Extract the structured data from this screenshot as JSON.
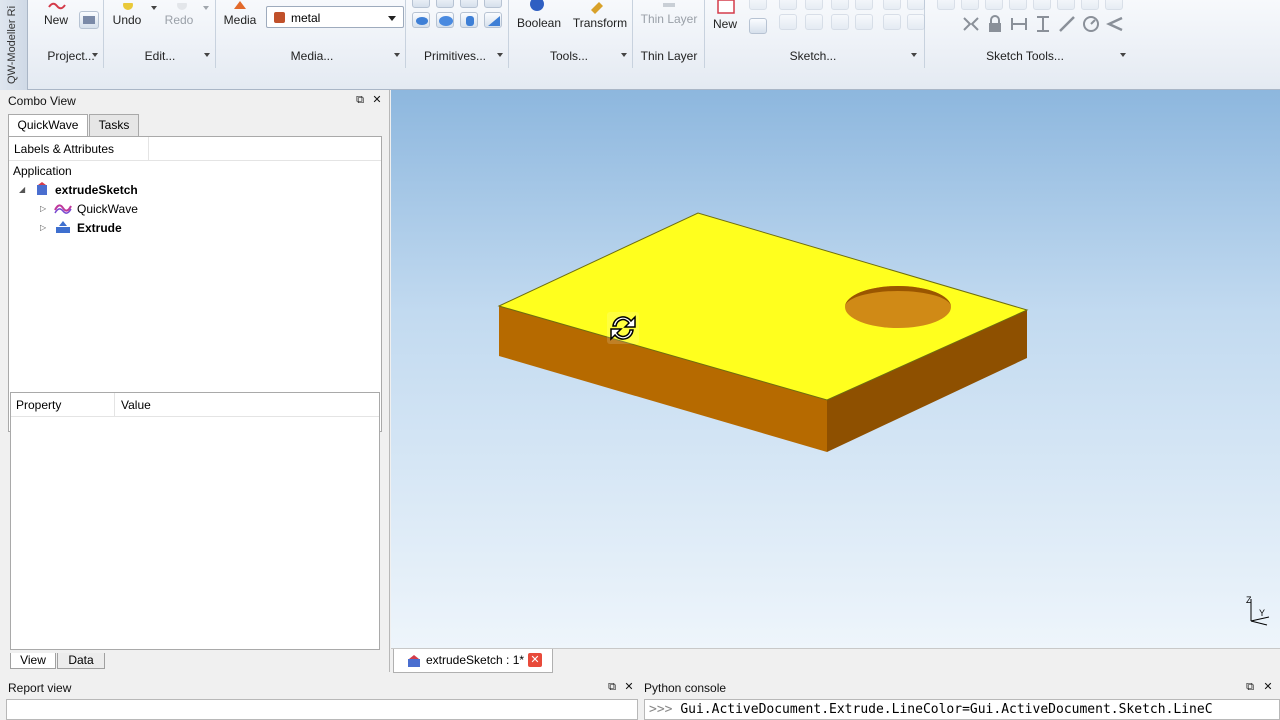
{
  "ribbon": {
    "side_label": "QW-Modeller Ri",
    "groups": {
      "project": {
        "label": "Project...",
        "new_label": "New"
      },
      "edit": {
        "label": "Edit...",
        "undo_label": "Undo",
        "redo_label": "Redo"
      },
      "media": {
        "label": "Media...",
        "media_label": "Media",
        "selected_media": "metal"
      },
      "primitives": {
        "label": "Primitives..."
      },
      "tools": {
        "label": "Tools...",
        "boolean_label": "Boolean",
        "transform_label": "Transform"
      },
      "thin_layer": {
        "label": "Thin Layer",
        "button_label": "Thin Layer"
      },
      "sketch": {
        "label": "Sketch...",
        "new_label": "New"
      },
      "sketch_tools": {
        "label": "Sketch Tools..."
      }
    }
  },
  "combo_view": {
    "title": "Combo View",
    "tabs": [
      "QuickWave",
      "Tasks"
    ],
    "tree": {
      "header": "Labels & Attributes",
      "root": "Application",
      "document": "extrudeSketch",
      "children": [
        "QuickWave",
        "Extrude"
      ]
    },
    "property": {
      "col_property": "Property",
      "col_value": "Value"
    },
    "bottom_tabs": [
      "View",
      "Data"
    ]
  },
  "document_tab": {
    "label": "extrudeSketch : 1*"
  },
  "axis_labels": {
    "y": "Y",
    "z": "Z"
  },
  "report_view": {
    "title": "Report view"
  },
  "python_console": {
    "title": "Python console",
    "prompt": ">>>",
    "line": "Gui.ActiveDocument.Extrude.LineColor=Gui.ActiveDocument.Sketch.LineC"
  },
  "colors": {
    "top_face": "#ffff1e",
    "side_face": "#b66a00",
    "bg_top": "#8db7de",
    "bg_bottom": "#eef5fb"
  }
}
